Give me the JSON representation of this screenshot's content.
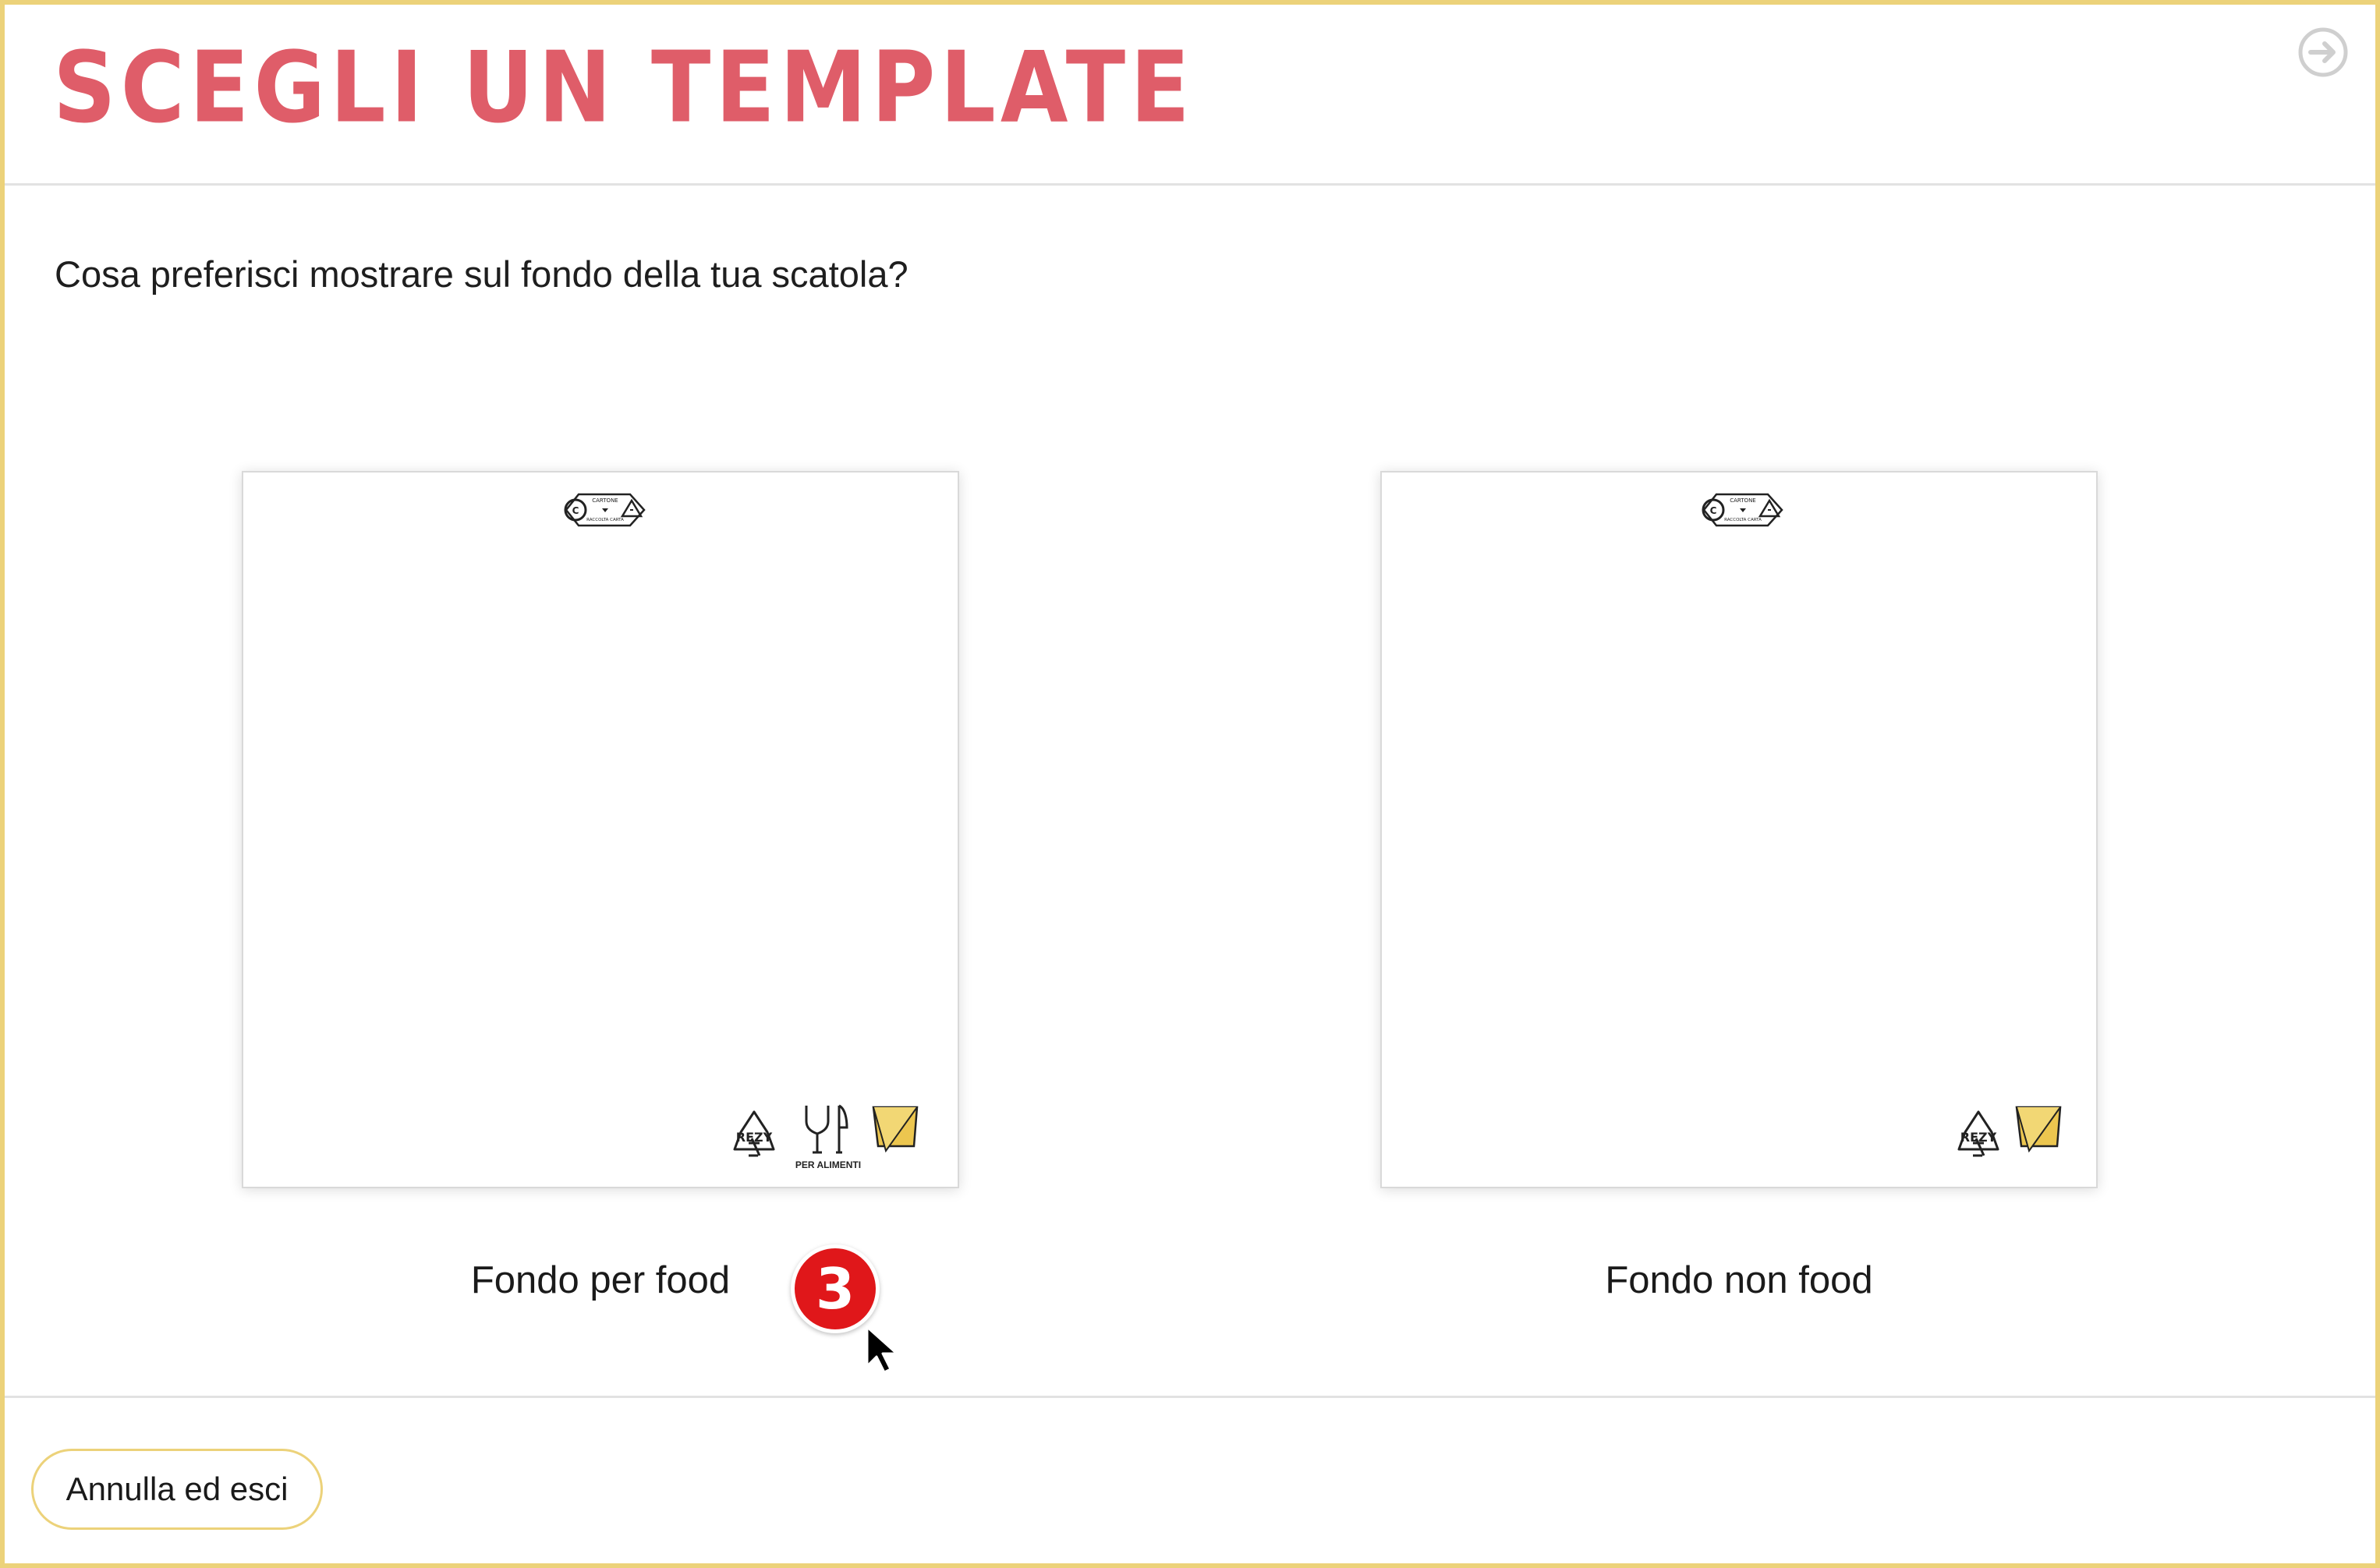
{
  "header": {
    "title": "SCEGLI UN TEMPLATE",
    "exit_icon": "arrow-circle-right-icon"
  },
  "main": {
    "question": "Cosa preferisci mostrare sul fondo della tua scatola?",
    "cards": [
      {
        "label": "Fondo per food",
        "marks": {
          "material_text": "CARTONE",
          "collection_text": "RACCOLTA CARTA",
          "rezy_text": "REZY",
          "food_text": "PER ALIMENTI"
        },
        "icons": [
          "recycling-code-icon",
          "rezy-recycle-icon",
          "food-safe-cutlery-icon",
          "fold-box-icon"
        ]
      },
      {
        "label": "Fondo non food",
        "marks": {
          "material_text": "CARTONE",
          "collection_text": "RACCOLTA CARTA",
          "rezy_text": "REZY"
        },
        "icons": [
          "recycling-code-icon",
          "rezy-recycle-icon",
          "fold-box-icon"
        ]
      }
    ]
  },
  "overlay": {
    "step_number": "3",
    "cursor_icon": "mouse-pointer-icon"
  },
  "footer": {
    "cancel_label": "Annulla ed esci"
  },
  "colors": {
    "accent_border": "#ecd27a",
    "title": "#df5d69",
    "step_badge": "#e0171a",
    "fold_yellow": "#ecc64f"
  }
}
